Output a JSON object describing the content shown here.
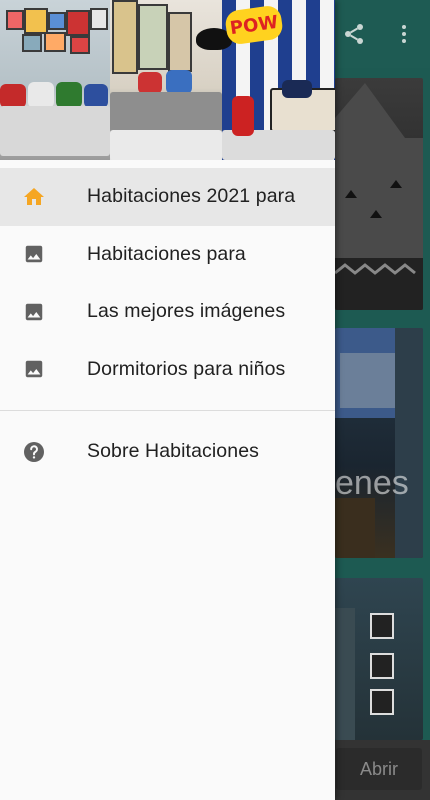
{
  "drawer": {
    "header_image_alt": "superhero-themed kids bedrooms collage",
    "header_badge_text": "POW",
    "items": [
      {
        "label": "Habitaciones 2021 para",
        "icon": "home-icon",
        "active": true
      },
      {
        "label": "Habitaciones para",
        "icon": "image-icon",
        "active": false
      },
      {
        "label": "Las mejores imágenes",
        "icon": "image-icon",
        "active": false
      },
      {
        "label": "Dormitorios para niños",
        "icon": "image-icon",
        "active": false
      }
    ],
    "secondary_items": [
      {
        "label": "Sobre Habitaciones",
        "icon": "help-icon"
      }
    ]
  },
  "background": {
    "toolbar_icons": [
      "share-icon",
      "more-vert-icon"
    ],
    "card_partial_text": "enes",
    "open_button_label": "Abrir"
  },
  "colors": {
    "active_icon": "#f5a623",
    "icon_grey": "#616161",
    "toolbar": "#1e5b53"
  }
}
